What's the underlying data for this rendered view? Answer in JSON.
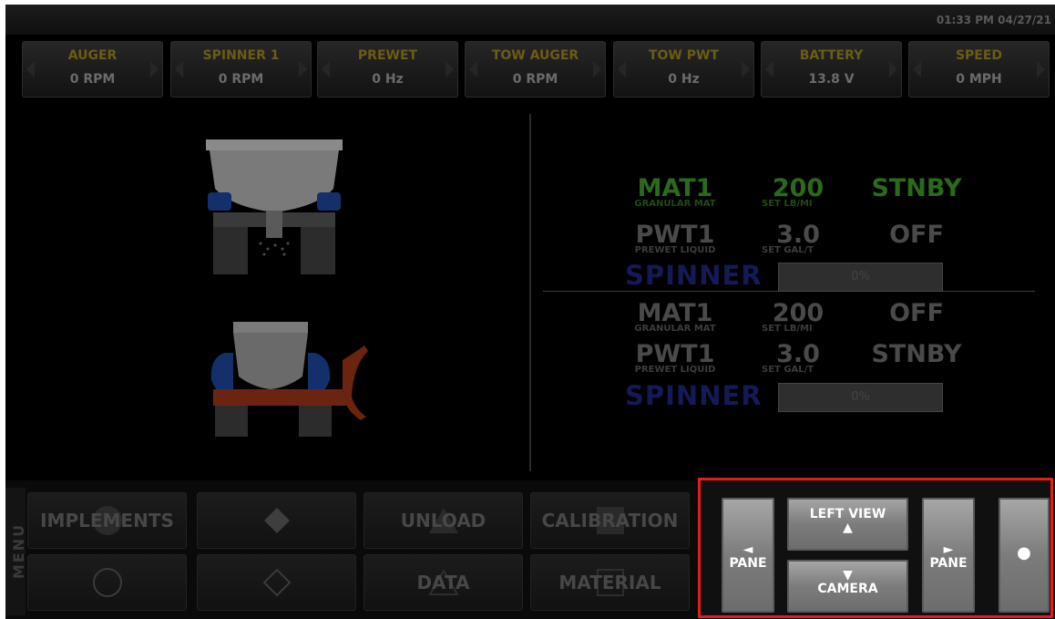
{
  "status_bar": {
    "datetime": "01:33 PM 04/27/21"
  },
  "gauges": [
    {
      "label": "AUGER",
      "value": "0 RPM"
    },
    {
      "label": "SPINNER 1",
      "value": "0 RPM"
    },
    {
      "label": "PREWET",
      "value": "0 Hz"
    },
    {
      "label": "TOW AUGER",
      "value": "0 RPM"
    },
    {
      "label": "TOW PWT",
      "value": "0 Hz"
    },
    {
      "label": "BATTERY",
      "value": "13.8 V"
    },
    {
      "label": "SPEED",
      "value": "0 MPH"
    }
  ],
  "truck": {
    "rows": [
      {
        "name": "MAT1",
        "sub": "GRANULAR MAT",
        "value": "200",
        "unit": "SET LB/MI",
        "status": "STNBY"
      },
      {
        "name": "PWT1",
        "sub": "PREWET LIQUID",
        "value": "3.0",
        "unit": "SET GAL/T",
        "status": "OFF"
      }
    ],
    "spinner": {
      "label": "SPINNER",
      "percent": "0%"
    }
  },
  "tow": {
    "rows": [
      {
        "name": "MAT1",
        "sub": "GRANULAR MAT",
        "value": "200",
        "unit": "SET LB/MI",
        "status": "OFF"
      },
      {
        "name": "PWT1",
        "sub": "PREWET LIQUID",
        "value": "3.0",
        "unit": "SET GAL/T",
        "status": "STNBY"
      }
    ],
    "spinner": {
      "label": "SPINNER",
      "percent": "0%"
    }
  },
  "menu": {
    "tab_label": "MENU",
    "buttons": {
      "implements": "IMPLEMENTS",
      "unload": "UNLOAD",
      "calibration": "CALIBRATION",
      "data": "DATA",
      "material": "MATERIAL"
    }
  },
  "controls": {
    "pane_left": {
      "arrow": "◄",
      "label": "PANE"
    },
    "left_view": {
      "label": "LEFT VIEW",
      "arrow": "▲"
    },
    "camera": {
      "arrow": "▼",
      "label": "CAMERA"
    },
    "pane_right": {
      "arrow": "►",
      "label": "PANE"
    },
    "dot": "●"
  },
  "colors": {
    "highlight": "#e41c1c",
    "active_green": "#2a6a1a",
    "spinner_blue": "#141a55"
  }
}
